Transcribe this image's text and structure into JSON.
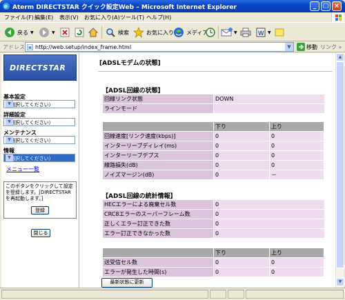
{
  "window": {
    "title": "Aterm DIRECTSTAR クイック設定Web – Microsoft Internet Explorer",
    "controls": {
      "minimize": "_",
      "maximize": "□",
      "close": "×"
    }
  },
  "menubar": [
    "ファイル(F)",
    "編集(E)",
    "表示(V)",
    "お気に入り(A)",
    "ツール(T)",
    "ヘルプ(H)"
  ],
  "toolbar": {
    "back_label": "戻る",
    "search_label": "検索",
    "favorites_label": "お気に入り",
    "media_label": "メディア"
  },
  "address": {
    "label": "アドレス(D)",
    "url": "http://web.setup/index_frame.html",
    "go_label": "移動",
    "links_label": "リンク »"
  },
  "sidebar": {
    "logo": "DIRECTSTAR",
    "groups": [
      {
        "label": "基本設定",
        "selected": "（選択してください）"
      },
      {
        "label": "詳細設定",
        "selected": "（選択してください）"
      },
      {
        "label": "メンテナンス",
        "selected": "（選択してください）"
      },
      {
        "label": "情報",
        "selected": "（選択してください）"
      }
    ],
    "menu_link": "メニュー一覧",
    "info_text": "このボタンをクリックして設定を登録します。[DIRECTSTARを再起動します。]",
    "register_button": "登録",
    "close_button": "閉じる"
  },
  "content": {
    "page_title": "[ADSLモデムの状態]",
    "line_status": {
      "heading": "【ADSL回線の状態】",
      "rows": [
        {
          "label": "回線リンク状態",
          "value": "DOWN"
        },
        {
          "label": "ラインモード",
          "value": ""
        }
      ]
    },
    "line_table": {
      "headers": [
        "",
        "下り",
        "上り"
      ],
      "rows": [
        {
          "label": "回線速度[リンク速度(kbps)]",
          "down": "0",
          "up": "0"
        },
        {
          "label": "インターリーブディレイ(ms)",
          "down": "0",
          "up": "0"
        },
        {
          "label": "インターリーブデプス",
          "down": "0",
          "up": "0"
        },
        {
          "label": "線路損失(dB)",
          "down": "0",
          "up": "0"
        },
        {
          "label": "ノイズマージン(dB)",
          "down": "0",
          "up": "－"
        }
      ]
    },
    "stats": {
      "heading": "【ADSL回線の統計情報】",
      "rows": [
        {
          "label": "HECエラーによる廃棄セル数",
          "value": "0"
        },
        {
          "label": "CRC8エラーのスーパーフレーム数",
          "value": "0"
        },
        {
          "label": "正しくエラー訂正できた数",
          "value": "0"
        },
        {
          "label": "エラー訂正できなかった数",
          "value": "0"
        }
      ]
    },
    "stats_table": {
      "headers": [
        "",
        "下り",
        "上り"
      ],
      "rows": [
        {
          "label": "送受信セル数",
          "down": "0",
          "up": "0"
        },
        {
          "label": "エラーが発生した時間(s)",
          "down": "0",
          "up": "0"
        }
      ]
    },
    "refresh_button": "最新状態に更新"
  }
}
